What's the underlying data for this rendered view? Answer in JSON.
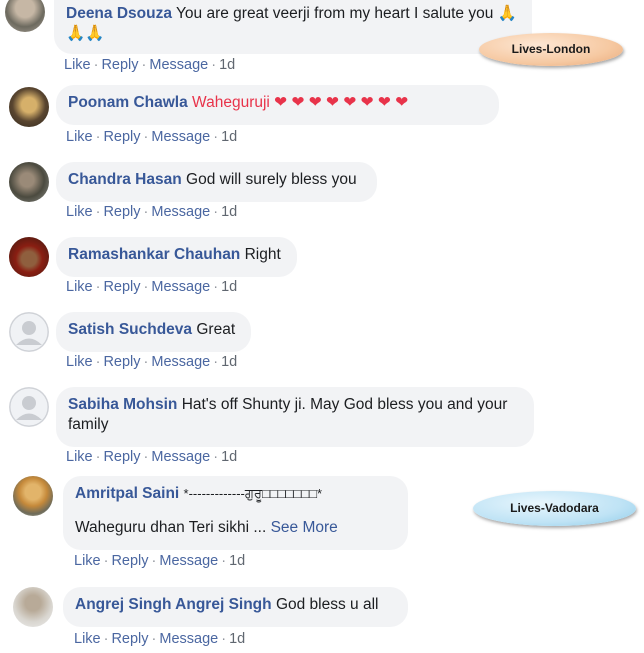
{
  "actions": {
    "like": "Like",
    "reply": "Reply",
    "message": "Message",
    "sep": "·"
  },
  "comments": [
    {
      "author": "Deena Dsouza",
      "text": "You are great veerji from my heart I salute you 🙏",
      "text2": "🙏🙏",
      "age": "1d"
    },
    {
      "author": "Poonam Chawla",
      "text": "Waheguruji ❤ ❤ ❤ ❤ ❤ ❤ ❤ ❤",
      "age": "1d"
    },
    {
      "author": "Chandra Hasan",
      "text": "God will surely bless you",
      "age": "1d"
    },
    {
      "author": "Ramashankar Chauhan",
      "text": "Right",
      "age": "1d"
    },
    {
      "author": "Satish Suchdeva",
      "text": "Great",
      "age": "1d"
    },
    {
      "author": "Sabiha Mohsin",
      "text": "Hat's off Shunty ji. May God bless you and your",
      "text2": "family",
      "age": "1d"
    },
    {
      "author": "Amritpal Saini",
      "text": "*-------------ਗੁਰੂ□□□□□□□*",
      "text2": "Waheguru dhan Teri sikhi",
      "see_more": "See More",
      "ellipsis": "...",
      "age": "1d"
    },
    {
      "author": "Angrej Singh Angrej Singh",
      "text": "God bless u all",
      "age": "1d"
    }
  ],
  "annotations": {
    "london": "Lives-London",
    "vadodara": "Lives-Vadodara"
  },
  "colors": {
    "author": "#385898",
    "bubble": "#f2f3f5",
    "link": "#4b67a1",
    "london_oval": "#f6c9a2",
    "vadodara_oval": "#bfe3f5"
  }
}
